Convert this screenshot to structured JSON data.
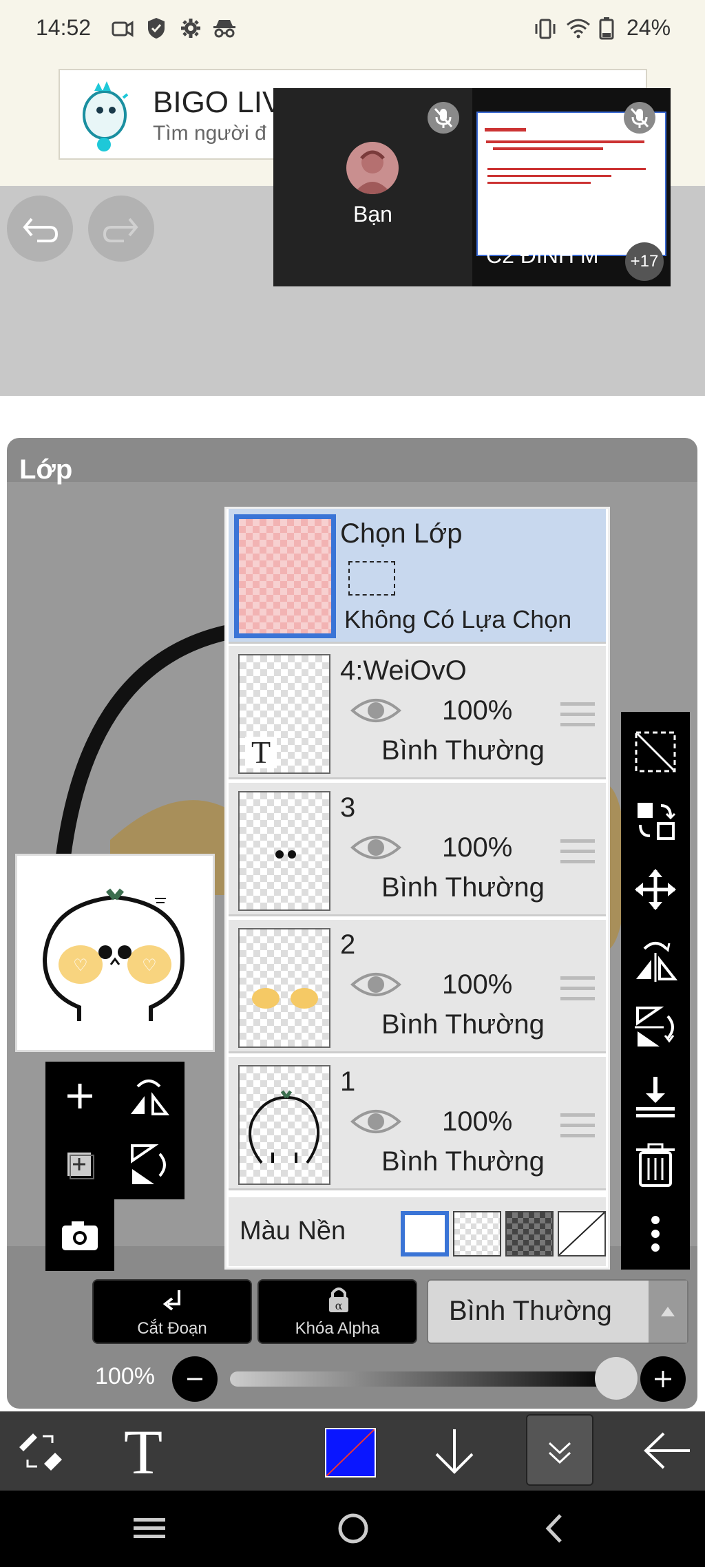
{
  "status_bar": {
    "time": "14:52",
    "battery": "24%",
    "icons": [
      "video-icon",
      "shield-icon",
      "settings-gear-icon",
      "incognito-icon",
      "vibrate-icon",
      "wifi-icon",
      "battery-icon"
    ]
  },
  "ad": {
    "title": "BIGO LIV",
    "subtitle": "Tìm người đ"
  },
  "video_call": {
    "self_label": "Bạn",
    "shared_name": "C2 ĐINH M",
    "participants_more": "+17"
  },
  "layers_panel": {
    "title": "Lớp",
    "selection": {
      "title": "Chọn Lớp",
      "status": "Không Có Lựa Chọn"
    },
    "layers": [
      {
        "name": "4:WeiOvO",
        "opacity": "100%",
        "blend": "Bình Thường",
        "thumb_letter": "T"
      },
      {
        "name": "3",
        "opacity": "100%",
        "blend": "Bình Thường"
      },
      {
        "name": "2",
        "opacity": "100%",
        "blend": "Bình Thường"
      },
      {
        "name": "1",
        "opacity": "100%",
        "blend": "Bình Thường"
      }
    ],
    "background_label": "Màu Nền",
    "background_options": [
      "white",
      "transparent",
      "dark-checker",
      "none"
    ]
  },
  "actions": {
    "clipping": "Cắt Đoạn",
    "alpha_lock": "Khóa Alpha",
    "blend_mode": "Bình Thường"
  },
  "opacity": {
    "label": "100%",
    "level_percent": 100
  },
  "colors": {
    "accent": "#3a74d6",
    "current_color": "#0a16ff",
    "panel": "#8a8a8a"
  }
}
